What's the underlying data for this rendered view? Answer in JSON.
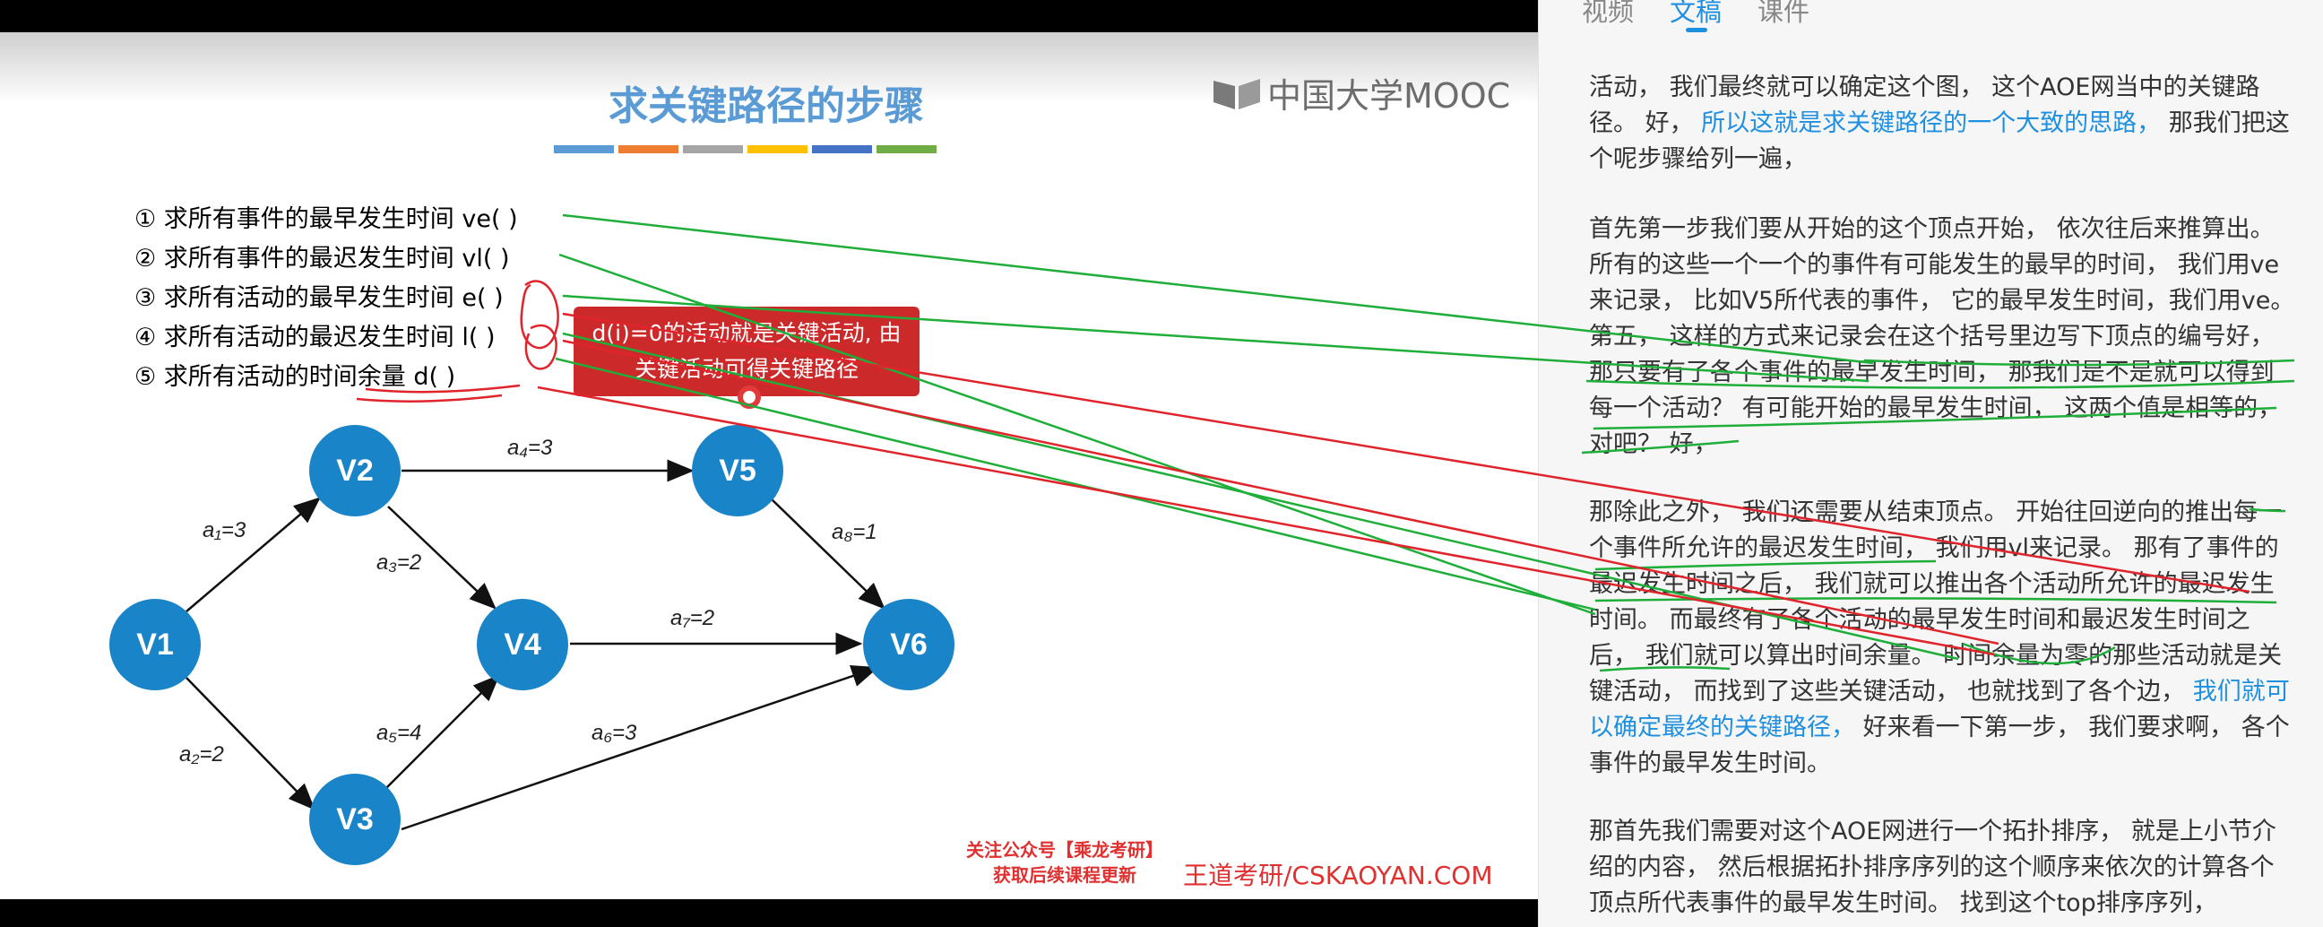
{
  "slide": {
    "title": "求关键路径的步骤",
    "title_bar_colors": [
      "#5b9bd5",
      "#ed7d31",
      "#a5a5a5",
      "#ffc000",
      "#4472c4",
      "#70ad47"
    ],
    "logo_text": "中国大学MOOC",
    "steps": [
      "① 求所有事件的最早发生时间 ve( )",
      "② 求所有事件的最迟发生时间 vl( )",
      "③ 求所有活动的最早发生时间 e( )",
      "④ 求所有活动的最迟发生时间 l( )",
      "⑤ 求所有活动的时间余量 d( )"
    ],
    "callout_lines": [
      "d(i)=0的活动就是关键活动, 由",
      "关键活动可得关键路径"
    ],
    "graph": {
      "nodes": [
        "V1",
        "V2",
        "V3",
        "V4",
        "V5",
        "V6"
      ],
      "edges": [
        {
          "from": "V1",
          "to": "V2",
          "label": "a₁=3"
        },
        {
          "from": "V1",
          "to": "V3",
          "label": "a₂=2"
        },
        {
          "from": "V2",
          "to": "V4",
          "label": "a₃=2"
        },
        {
          "from": "V2",
          "to": "V5",
          "label": "a₄=3"
        },
        {
          "from": "V3",
          "to": "V4",
          "label": "a₅=4"
        },
        {
          "from": "V3",
          "to": "V6",
          "label": "a₆=3"
        },
        {
          "from": "V4",
          "to": "V6",
          "label": "a₇=2"
        },
        {
          "from": "V5",
          "to": "V6",
          "label": "a₈=1"
        }
      ]
    },
    "promo_lines": [
      "关注公众号【乘龙考研】",
      "获取后续课程更新"
    ],
    "watermark": "王道考研/CSKAOYAN.COM"
  },
  "panel": {
    "tabs": [
      {
        "label": "视频",
        "active": false
      },
      {
        "label": "文稿",
        "active": true
      },
      {
        "label": "课件",
        "active": false
      }
    ],
    "paragraphs": [
      [
        {
          "t": "活动， 我们最终就可以确定这个图， 这个AOE网当中的关键路径。 好， ",
          "hl": false
        },
        {
          "t": "所以这就是求关键路径的一个大致的思路，",
          "hl": true
        },
        {
          "t": " 那我们把这个呢步骤给列一遍，",
          "hl": false
        }
      ],
      [
        {
          "t": "首先第一步我们要从开始的这个顶点开始， 依次往后来推算出。 所有的这些一个一个的事件有可能发生的最早的时间， 我们用ve来记录， 比如V5所代表的事件， 它的最早发生时间，我们用ve。 第五， 这样的方式来记录会在这个括号里边写下顶点的编号好， 那只要有了各个事件的最早发生时间， 那我们是不是就可以得到每一个活动？ 有可能开始的最早发生时间， 这两个值是相等的， 对吧？ 好，",
          "hl": false
        }
      ],
      [
        {
          "t": "那除此之外， 我们还需要从结束顶点。 开始往回逆向的推出每一个事件所允许的最迟发生时间， 我们用vl来记录。 那有了事件的最迟发生时间之后， 我们就可以推出各个活动所允许的最迟发生时间。 而最终有了各个活动的最早发生时间和最迟发生时间之后， 我们就可以算出时间余量。 时间余量为零的那些活动就是关键活动， 而找到了这些关键活动， 也就找到了各个边， ",
          "hl": false
        },
        {
          "t": "我们就可以确定最终的关键路径，",
          "hl": true
        },
        {
          "t": " 好来看一下第一步， 我们要求啊， 各个事件的最早发生时间。",
          "hl": false
        }
      ],
      [
        {
          "t": "那首先我们需要对这个AOE网进行一个拓扑排序， 就是上小节介绍的内容， 然后根据拓扑排序序列的这个顺序来依次的计算各个顶点所代表事件的最早发生时间。 找到这个top排序序列，",
          "hl": false
        }
      ]
    ]
  },
  "colors": {
    "node_fill": "#1a84c8",
    "accent_blue": "#1f8fe0",
    "annotation_green": "#1fae3a",
    "annotation_red": "#e0242c"
  }
}
